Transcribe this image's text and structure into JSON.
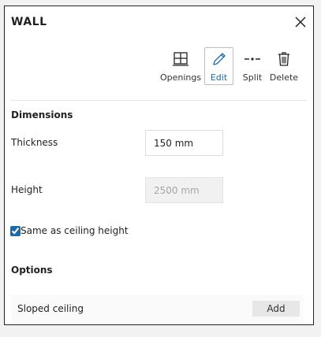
{
  "panel": {
    "title": "WALL"
  },
  "toolbar": {
    "items": [
      {
        "label": "Openings",
        "icon": "window-icon"
      },
      {
        "label": "Edit",
        "icon": "pencil-icon",
        "active": true
      },
      {
        "label": "Split",
        "icon": "split-icon"
      },
      {
        "label": "Delete",
        "icon": "trash-icon"
      }
    ]
  },
  "dimensions": {
    "heading": "Dimensions",
    "thickness_label": "Thickness",
    "thickness_value": "150 mm",
    "height_label": "Height",
    "height_value": "2500 mm",
    "same_as_ceiling_label": "Same as ceiling height",
    "same_as_ceiling_checked": true
  },
  "options": {
    "heading": "Options",
    "rows": [
      {
        "label": "Sloped ceiling",
        "action": "Add"
      }
    ]
  },
  "colors": {
    "accent": "#1f6aa5",
    "border": "#222222"
  }
}
